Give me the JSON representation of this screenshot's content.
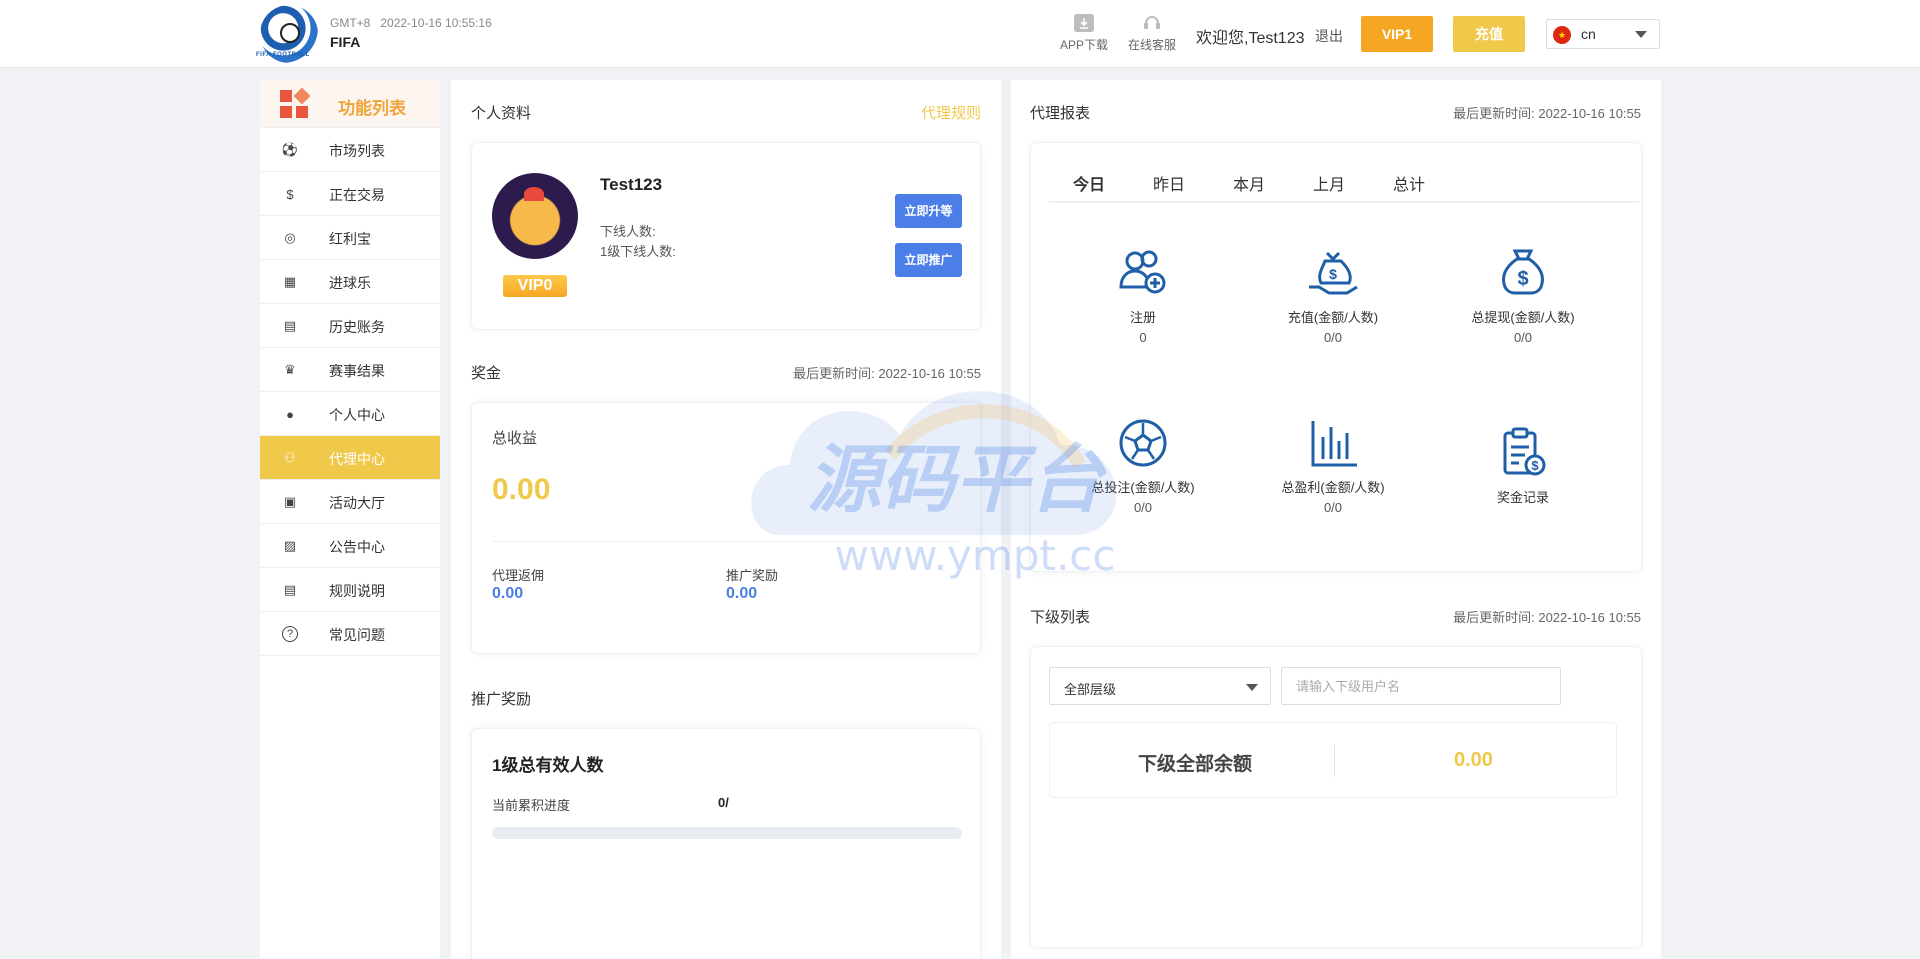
{
  "header": {
    "timezone": "GMT+8",
    "datetime": "2022-10-16 10:55:16",
    "site_name": "FIFA",
    "logo_text": "FIFA FOOTBALL",
    "app_download": "APP下载",
    "online_service": "在线客服",
    "welcome": "欢迎您,Test123",
    "logout": "退出",
    "vip_button": "VIP1",
    "recharge_button": "充值",
    "language": "cn"
  },
  "sidebar": {
    "title": "功能列表",
    "items": [
      {
        "label": "市场列表",
        "icon": "soccer-ball-icon"
      },
      {
        "label": "正在交易",
        "icon": "dollar-card-icon"
      },
      {
        "label": "红利宝",
        "icon": "coins-icon"
      },
      {
        "label": "进球乐",
        "icon": "goal-net-icon"
      },
      {
        "label": "历史账务",
        "icon": "history-ledger-icon"
      },
      {
        "label": "赛事结果",
        "icon": "trophy-icon"
      },
      {
        "label": "个人中心",
        "icon": "user-gear-icon"
      },
      {
        "label": "代理中心",
        "icon": "network-icon"
      },
      {
        "label": "活动大厅",
        "icon": "gift-icon"
      },
      {
        "label": "公告中心",
        "icon": "announcement-icon"
      },
      {
        "label": "规则说明",
        "icon": "document-icon"
      },
      {
        "label": "常见问题",
        "icon": "question-icon"
      }
    ],
    "active_index": 7
  },
  "profile": {
    "title": "个人资料",
    "rules_link": "代理规则",
    "username": "Test123",
    "vip_level": "VIP0",
    "downline_label": "下线人数:",
    "level1_label": "1级下线人数:",
    "upgrade_button": "立即升等",
    "promote_button": "立即推广"
  },
  "bonus": {
    "title": "奖金",
    "updated": "最后更新时间: 2022-10-16 10:55",
    "total_label": "总收益",
    "total_value": "0.00",
    "commission_label": "代理返佣",
    "commission_value": "0.00",
    "promo_label": "推广奖励",
    "promo_value": "0.00"
  },
  "promotion": {
    "title": "推广奖励",
    "heading": "1级总有效人数",
    "progress_label": "当前累积进度",
    "progress_value": "0/",
    "progress_fraction": 0
  },
  "report": {
    "title": "代理报表",
    "updated": "最后更新时间: 2022-10-16 10:55",
    "tabs": [
      "今日",
      "昨日",
      "本月",
      "上月",
      "总计"
    ],
    "active_tab": 0,
    "stats": [
      {
        "label": "注册",
        "value": "0",
        "icon": "user-add-icon"
      },
      {
        "label": "充值(金额/人数)",
        "value": "0/0",
        "icon": "money-bag-hand-icon"
      },
      {
        "label": "总提现(金额/人数)",
        "value": "0/0",
        "icon": "money-bag-icon"
      },
      {
        "label": "总投注(金额/人数)",
        "value": "0/0",
        "icon": "soccer-ball-icon"
      },
      {
        "label": "总盈利(金额/人数)",
        "value": "0/0",
        "icon": "bar-chart-icon"
      },
      {
        "label": "奖金记录",
        "value": "",
        "icon": "clipboard-dollar-icon"
      }
    ]
  },
  "downline": {
    "title": "下级列表",
    "updated": "最后更新时间: 2022-10-16 10:55",
    "level_select": "全部层级",
    "search_placeholder": "请输入下级用户名",
    "balance_label": "下级全部余额",
    "balance_value": "0.00"
  },
  "watermark": {
    "title": "源码平台",
    "url": "www.ympt.cc"
  },
  "colors": {
    "accent_yellow": "#f0c84a",
    "accent_orange": "#f5a623",
    "blue": "#4c7ee8",
    "icon_blue": "#1f5fa8"
  }
}
